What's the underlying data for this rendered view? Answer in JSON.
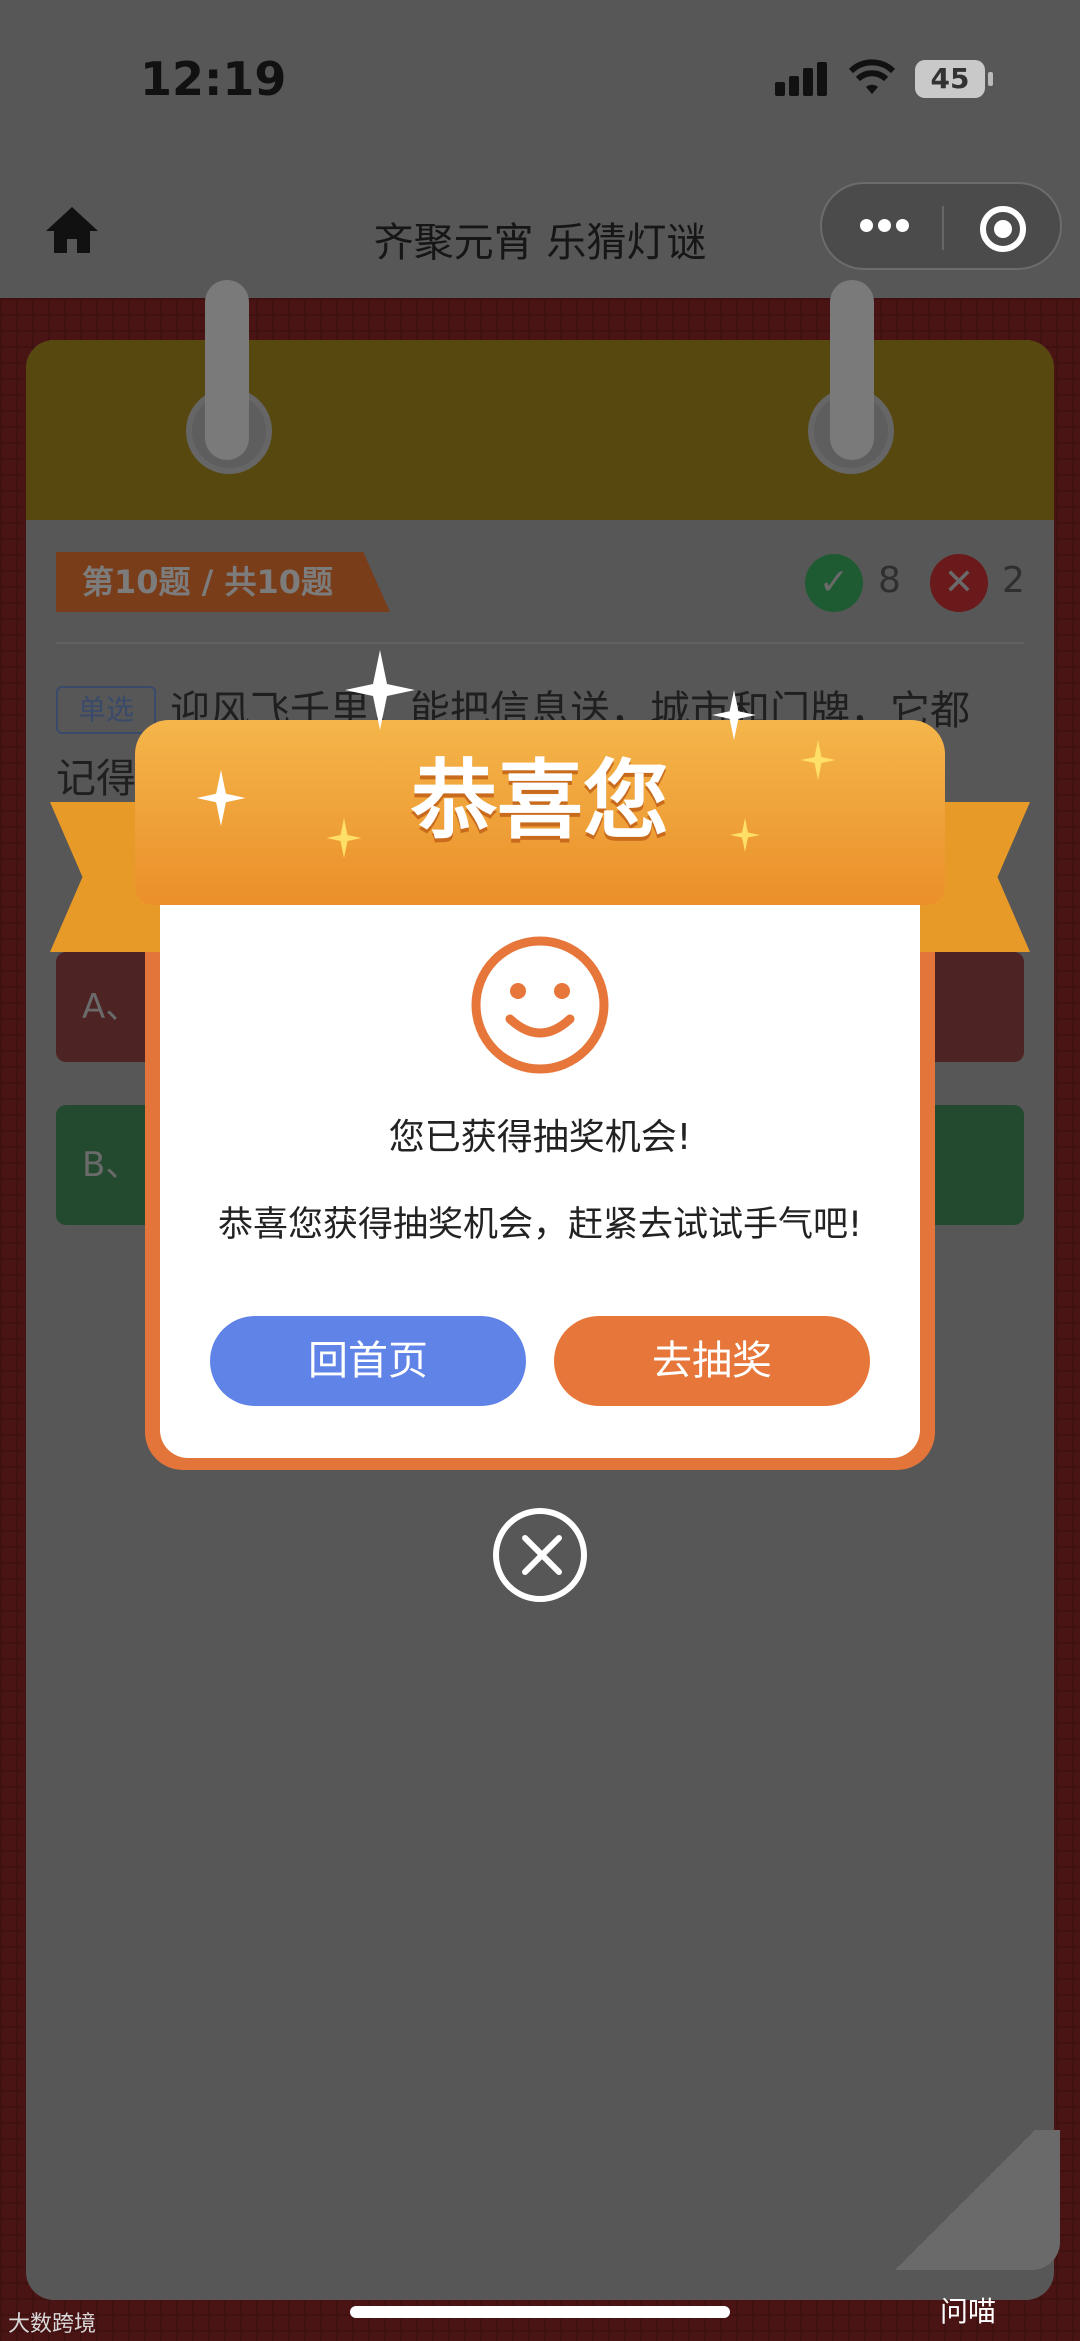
{
  "status_bar": {
    "time": "12:19",
    "battery": "45"
  },
  "nav": {
    "title": "齐聚元宵 乐猜灯谜"
  },
  "quiz": {
    "progress": "第10题 / 共10题",
    "correct_count": "8",
    "wrong_count": "2",
    "type": "单选",
    "question_line1": "迎风飞千里，能把信息送，城市和门牌，它都",
    "question_line2": "记得",
    "option_a": "A、",
    "option_b": "B、"
  },
  "modal": {
    "title": "恭喜您",
    "message": "您已获得抽奖机会!",
    "detail": "恭喜您获得抽奖机会，赶紧去试试手气吧!",
    "home_button": "回首页",
    "draw_button": "去抽奖"
  },
  "footer": {
    "watermark_left": "大数跨境",
    "watermark_right": "问喵"
  },
  "colors": {
    "accent_orange": "#e6763a",
    "button_blue": "#5f83e6",
    "ribbon": "#eb8f2a"
  }
}
